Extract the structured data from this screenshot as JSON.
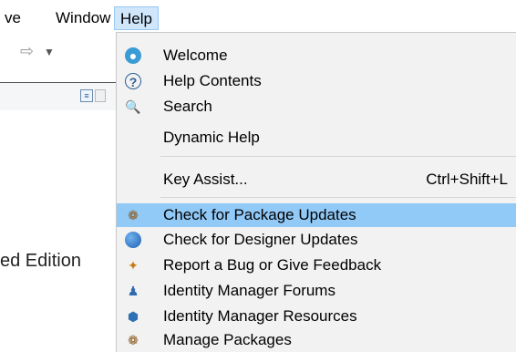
{
  "menubar": {
    "items": [
      "ve",
      "Window",
      "Help"
    ]
  },
  "toolbar": {
    "forward_icon": "forward-arrow-icon",
    "dropdown_icon": "chevron-down-icon"
  },
  "background": {
    "edition_text": "ed Edition"
  },
  "help_menu": {
    "items": [
      {
        "label": "Welcome",
        "icon": "welcome-icon"
      },
      {
        "label": "Help Contents",
        "icon": "help-contents-icon"
      },
      {
        "label": "Search",
        "icon": "search-icon"
      },
      {
        "label": "Dynamic Help",
        "icon": ""
      },
      {
        "label": "Key Assist...",
        "shortcut": "Ctrl+Shift+L"
      },
      {
        "label": "Check for Package Updates",
        "icon": "package-updates-icon",
        "highlighted": true
      },
      {
        "label": "Check for Designer Updates",
        "icon": "globe-icon"
      },
      {
        "label": "Report a Bug or Give Feedback",
        "icon": "bug-icon"
      },
      {
        "label": "Identity Manager Forums",
        "icon": "forums-icon"
      },
      {
        "label": "Identity Manager Resources",
        "icon": "resources-icon"
      },
      {
        "label": "Manage Packages",
        "icon": "manage-packages-icon"
      }
    ]
  },
  "colors": {
    "highlight": "#91c9f7",
    "menu_bg": "#f2f2f2",
    "menubar_active": "#cfe6fb"
  }
}
